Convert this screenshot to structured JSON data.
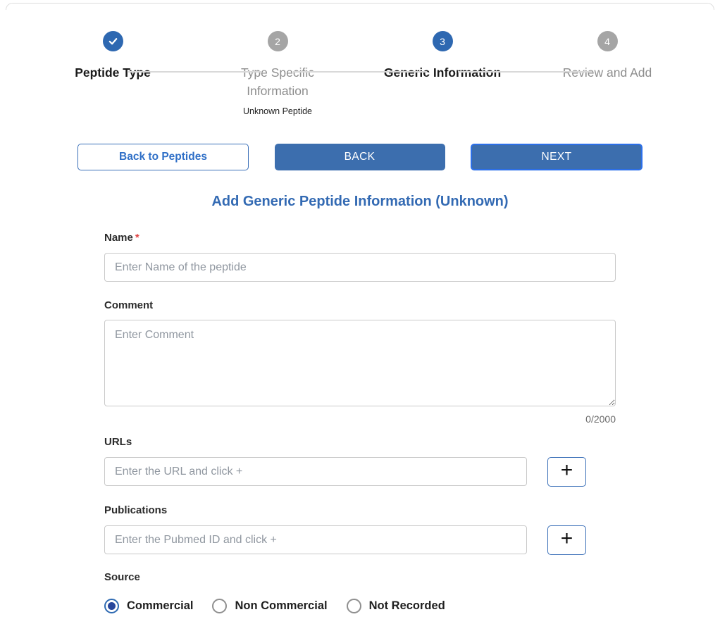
{
  "stepper": {
    "steps": [
      {
        "number": "1",
        "label": "Peptide Type",
        "sublabel": "",
        "state": "completed",
        "icon": "check"
      },
      {
        "number": "2",
        "label": "Type Specific Information",
        "sublabel": "Unknown Peptide",
        "state": "inactive"
      },
      {
        "number": "3",
        "label": "Generic Information",
        "sublabel": "",
        "state": "active"
      },
      {
        "number": "4",
        "label": "Review and Add",
        "sublabel": "",
        "state": "inactive"
      }
    ]
  },
  "toolbar": {
    "back_to_peptides_label": "Back to Peptides",
    "back_label": "BACK",
    "next_label": "NEXT"
  },
  "form": {
    "title": "Add Generic Peptide Information (Unknown)",
    "name": {
      "label": "Name",
      "required_marker": "*",
      "placeholder": "Enter Name of the peptide",
      "value": ""
    },
    "comment": {
      "label": "Comment",
      "placeholder": "Enter Comment",
      "value": "",
      "char_count": "0/2000"
    },
    "urls": {
      "label": "URLs",
      "placeholder": "Enter the URL and click +",
      "value": "",
      "add_button_label": "+"
    },
    "publications": {
      "label": "Publications",
      "placeholder": "Enter the Pubmed ID and click +",
      "value": "",
      "add_button_label": "+"
    },
    "source": {
      "label": "Source",
      "options": [
        {
          "label": "Commercial",
          "selected": true
        },
        {
          "label": "Non Commercial",
          "selected": false
        },
        {
          "label": "Not Recorded",
          "selected": false
        }
      ]
    }
  },
  "colors": {
    "primary_blue": "#2e68b1",
    "button_fill_blue": "#3c6eae",
    "next_focus_border": "#2c6fe8",
    "title_blue": "#336ab3",
    "inactive_gray": "#a5a5a5",
    "required_red": "#e04646",
    "selected_radio_dot": "#28479c"
  }
}
